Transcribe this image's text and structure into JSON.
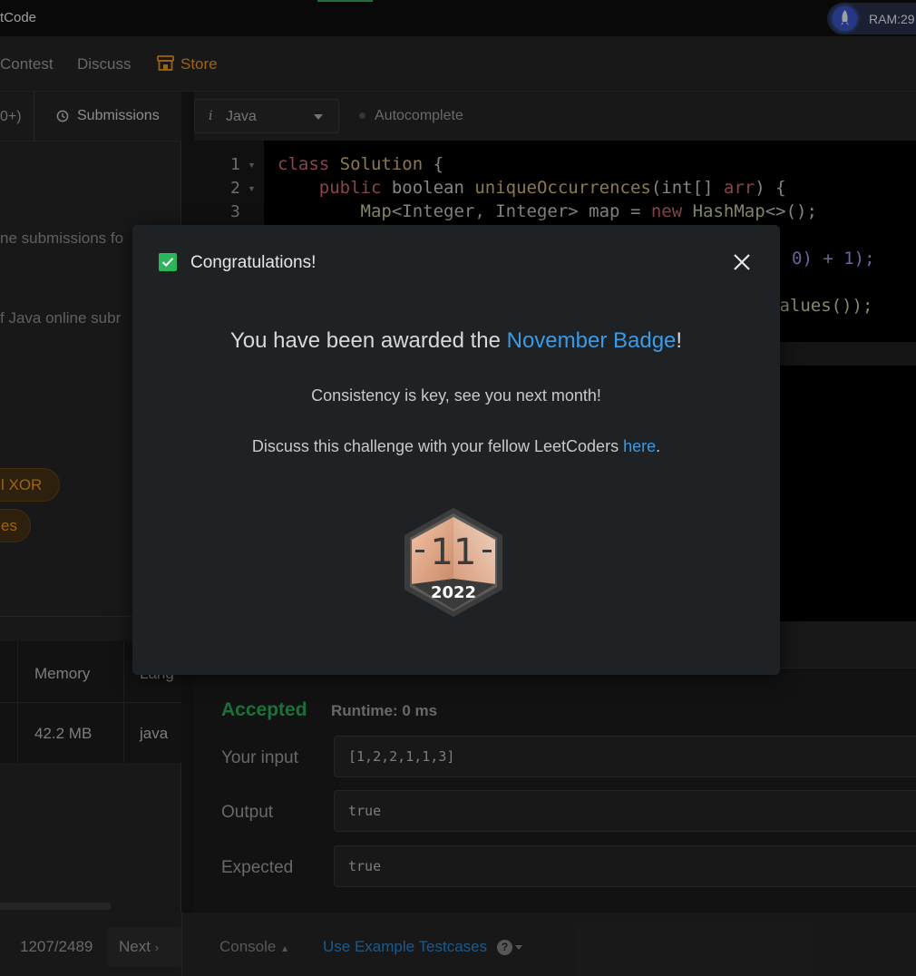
{
  "titlebar": {
    "app_title": "tCode",
    "ram_label": "RAM:29"
  },
  "nav": {
    "contest": "Contest",
    "discuss": "Discuss",
    "store": "Store"
  },
  "left": {
    "tab_prev": "0+)",
    "tab_submissions": "Submissions",
    "text_line1": "ne submissions fo",
    "text_line2": "f Java online subr",
    "tags": [
      "l XOR",
      "es"
    ],
    "table": {
      "headers": [
        "Memory",
        "Lang"
      ],
      "row": [
        "42.2 MB",
        "java"
      ]
    },
    "pager": "1207/2489",
    "next": "Next"
  },
  "editor": {
    "language": "Java",
    "autocomplete": "Autocomplete",
    "line_numbers": [
      "1",
      "2",
      "3"
    ],
    "line4_tail": "0) + 1);",
    "line5_tail": "values());"
  },
  "result": {
    "status": "Accepted",
    "runtime": "Runtime: 0 ms",
    "rows": [
      {
        "label": "Your input",
        "value": "[1,2,2,1,1,3]"
      },
      {
        "label": "Output",
        "value": "true"
      },
      {
        "label": "Expected",
        "value": "true"
      }
    ]
  },
  "bottom": {
    "console": "Console",
    "example": "Use Example Testcases"
  },
  "modal": {
    "title": "Congratulations!",
    "award_prefix": "You have been awarded the ",
    "badge_name": "November Badge",
    "award_suffix": "!",
    "consistency": "Consistency is key, see you next month!",
    "discuss_prefix": "Discuss this challenge with your fellow LeetCoders ",
    "discuss_link": "here",
    "discuss_suffix": ".",
    "badge_month": "11",
    "badge_year": "2022"
  },
  "colors": {
    "accent_green": "#2db55d",
    "link_blue": "#3b9ae6",
    "brand_orange": "#ffa116"
  }
}
